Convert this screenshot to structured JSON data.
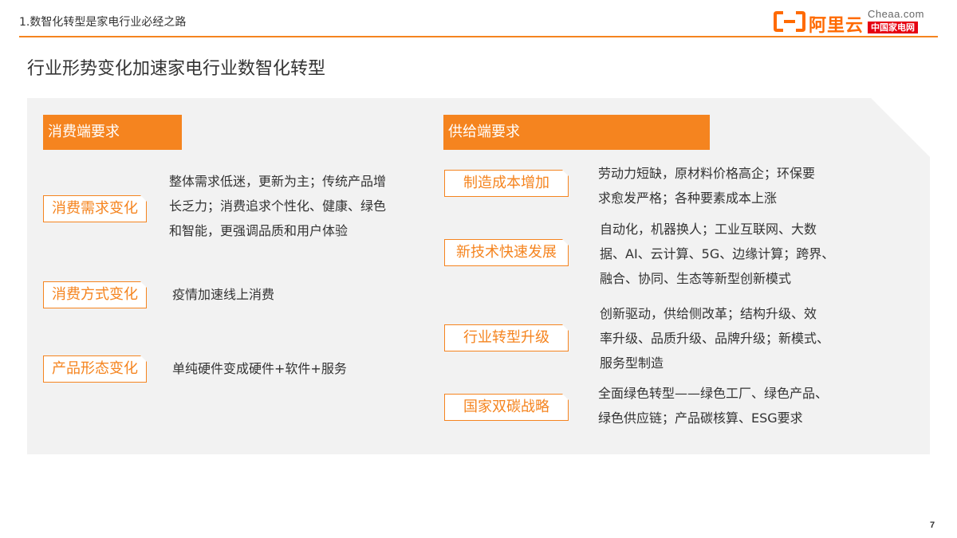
{
  "header": {
    "section_title": "1.数智化转型是家电行业必经之路"
  },
  "logo": {
    "brand_name": "阿里云",
    "partner_en": "Cheaa.com",
    "partner_cn": "中国家电网"
  },
  "colors": {
    "accent": "#F5841F",
    "panel_bg": "#F2F2F2",
    "text": "#333333"
  },
  "slide": {
    "title": "行业形势变化加速家电行业数智化转型",
    "page_number": "7"
  },
  "consumer": {
    "header": "消费端要求",
    "items": [
      {
        "tag": "消费需求变化",
        "desc_lines": [
          "整体需求低迷，更新为主；传统产品增",
          "长乏力；消费追求个性化、健康、绿色",
          "和智能，更强调品质和用户体验"
        ]
      },
      {
        "tag": "消费方式变化",
        "desc_lines": [
          "疫情加速线上消费"
        ]
      },
      {
        "tag": "产品形态变化",
        "desc_lines": [
          "单纯硬件变成硬件+软件+服务"
        ]
      }
    ]
  },
  "supply": {
    "header": "供给端要求",
    "items": [
      {
        "tag": "制造成本增加",
        "desc_lines": [
          "劳动力短缺，原材料价格高企；环保要",
          "求愈发严格；各种要素成本上涨"
        ]
      },
      {
        "tag": "新技术快速发展",
        "desc_lines": [
          "自动化，机器换人；工业互联网、大数",
          "据、AI、云计算、5G、边缘计算；跨界、",
          "融合、协同、生态等新型创新模式"
        ]
      },
      {
        "tag": "行业转型升级",
        "desc_lines": [
          "创新驱动，供给侧改革；结构升级、效",
          "率升级、品质升级、品牌升级；新模式、",
          "服务型制造"
        ]
      },
      {
        "tag": "国家双碳战略",
        "desc_lines": [
          "全面绿色转型——绿色工厂、绿色产品、",
          "绿色供应链；产品碳核算、ESG要求"
        ]
      }
    ]
  }
}
